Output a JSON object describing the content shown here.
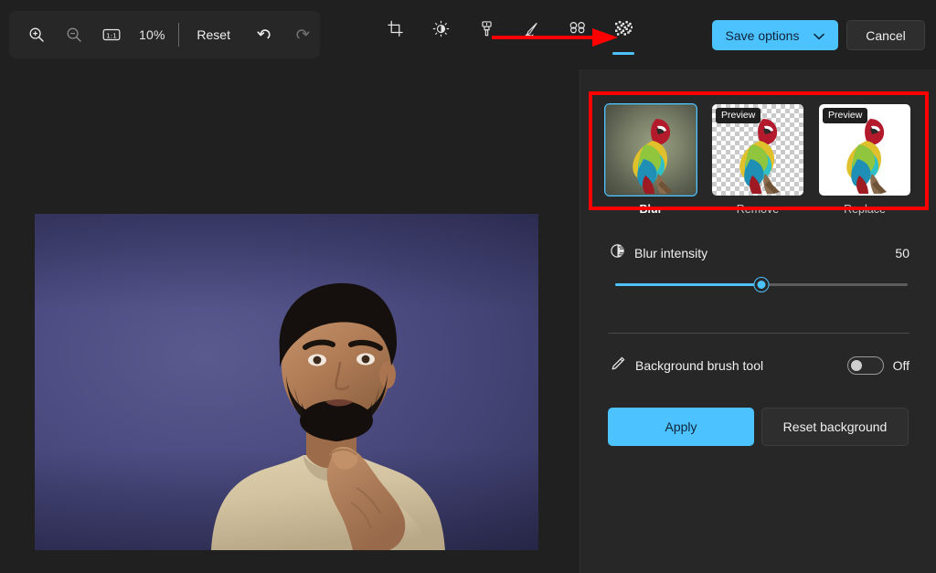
{
  "toolbar": {
    "zoom_in_icon": "zoom-in-icon",
    "zoom_out_icon": "zoom-out-icon",
    "actual_size_icon": "one-to-one-icon",
    "zoom_level": "10%",
    "reset_label": "Reset",
    "undo_icon": "undo-icon",
    "redo_icon": "redo-icon"
  },
  "tools": [
    {
      "name": "crop",
      "icon": "crop-icon",
      "active": false
    },
    {
      "name": "adjustments",
      "icon": "brightness-icon",
      "active": false
    },
    {
      "name": "markup",
      "icon": "paintbrush-icon",
      "active": false
    },
    {
      "name": "pen",
      "icon": "pen-signature-icon",
      "active": false
    },
    {
      "name": "erase",
      "icon": "erase-icon",
      "active": false
    },
    {
      "name": "background",
      "icon": "background-mosaic-icon",
      "active": true
    }
  ],
  "actions": {
    "save_label": "Save options",
    "save_chevron_icon": "chevron-down-icon",
    "cancel_label": "Cancel"
  },
  "annotation": {
    "arrow_color": "#ff0000",
    "highlight_color": "#ff0000"
  },
  "canvas": {
    "image_description": "Portrait photo of a man in a beige shirt pointing, on a purple gradient background"
  },
  "panel": {
    "background_options": [
      {
        "label": "Blur",
        "selected": true,
        "badge": null,
        "thumb_style": "blurred-photo"
      },
      {
        "label": "Remove",
        "selected": false,
        "badge": "Preview",
        "thumb_style": "transparent-checkerboard"
      },
      {
        "label": "Replace",
        "selected": false,
        "badge": "Preview",
        "thumb_style": "white"
      }
    ],
    "intensity": {
      "icon": "contrast-icon",
      "label": "Blur intensity",
      "value": "50",
      "percent": 50
    },
    "brush": {
      "icon": "pencil-icon",
      "label": "Background brush tool",
      "toggle_state": "Off",
      "toggle_on": false
    },
    "buttons": {
      "apply_label": "Apply",
      "reset_background_label": "Reset background"
    }
  },
  "colors": {
    "accent": "#4cc2ff",
    "panel_bg": "#272727",
    "app_bg": "#202020",
    "annotation_red": "#ff0000"
  }
}
